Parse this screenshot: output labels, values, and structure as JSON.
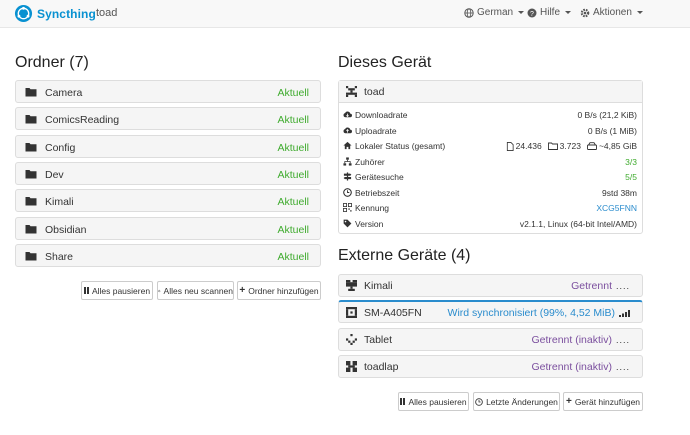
{
  "nav": {
    "brand": "Syncthing",
    "device": "toad",
    "language": "German",
    "help": "Hilfe",
    "actions": "Aktionen"
  },
  "folders": {
    "title": "Ordner (7)",
    "items": [
      {
        "name": "Camera",
        "status": "Aktuell"
      },
      {
        "name": "ComicsReading",
        "status": "Aktuell"
      },
      {
        "name": "Config",
        "status": "Aktuell"
      },
      {
        "name": "Dev",
        "status": "Aktuell"
      },
      {
        "name": "Kimali",
        "status": "Aktuell"
      },
      {
        "name": "Obsidian",
        "status": "Aktuell"
      },
      {
        "name": "Share",
        "status": "Aktuell"
      }
    ],
    "buttons": {
      "pause_all": "Alles pausieren",
      "rescan_all": "Alles neu scannen",
      "add_folder": "Ordner hinzufügen"
    }
  },
  "this_device": {
    "title": "Dieses Gerät",
    "name": "toad",
    "rows": {
      "download": {
        "label": "Downloadrate",
        "value": "0 B/s (21,2 KiB)"
      },
      "upload": {
        "label": "Uploadrate",
        "value": "0 B/s (1 MiB)"
      },
      "local": {
        "label": "Lokaler Status (gesamt)",
        "files": "24.436",
        "dirs": "3.723",
        "size": "~4,85 GiB"
      },
      "listeners": {
        "label": "Zuhörer",
        "value": "3/3"
      },
      "discovery": {
        "label": "Gerätesuche",
        "value": "5/5"
      },
      "uptime": {
        "label": "Betriebszeit",
        "value": "9std 38m"
      },
      "id": {
        "label": "Kennung",
        "value": "XCG5FNN"
      },
      "version": {
        "label": "Version",
        "value": "v2.1.1, Linux (64-bit Intel/AMD)"
      }
    }
  },
  "remote": {
    "title": "Externe Geräte (4)",
    "items": [
      {
        "name": "Kimali",
        "status": "Getrennt",
        "dots": "...."
      },
      {
        "name": "SM-A405FN",
        "status": "Wird synchronisiert (99%, 4,52 MiB)"
      },
      {
        "name": "Tablet",
        "status": "Getrennt (inaktiv)",
        "dots": "...."
      },
      {
        "name": "toadlap",
        "status": "Getrennt (inaktiv)",
        "dots": "...."
      }
    ],
    "buttons": {
      "pause_all": "Alles pausieren",
      "recent": "Letzte Änderungen",
      "add_device": "Gerät hinzufügen"
    }
  },
  "colors": {
    "accent": "#0891d1",
    "up_to_date": "#3fab2e",
    "disconnected": "#7b4f9e",
    "syncing": "#2a8ccd"
  }
}
